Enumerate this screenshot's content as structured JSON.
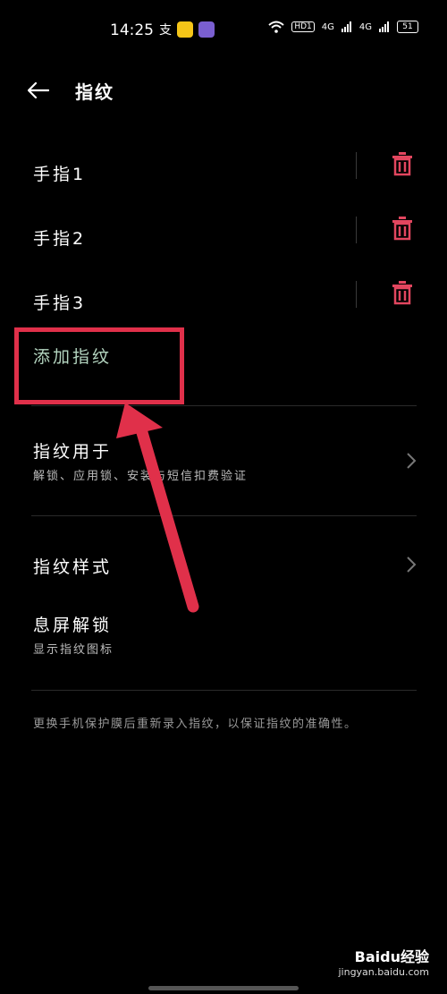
{
  "status_bar": {
    "time": "14:25",
    "hd_label": "HD1",
    "net1": "4G",
    "net2": "4G",
    "battery": "51"
  },
  "header": {
    "title": "指纹"
  },
  "fingers": [
    {
      "label": "手指1"
    },
    {
      "label": "手指2"
    },
    {
      "label": "手指3"
    }
  ],
  "add_fingerprint_label": "添加指纹",
  "fingerprint_use": {
    "title": "指纹用于",
    "subtitle": "解锁、应用锁、安装与短信扣费验证"
  },
  "fingerprint_style": {
    "title": "指纹样式"
  },
  "screen_off_unlock": {
    "title": "息屏解锁",
    "subtitle": "显示指纹图标"
  },
  "note": "更换手机保护膜后重新录入指纹，以保证指纹的准确性。",
  "watermark": {
    "brand": "Baidu经验",
    "url": "jingyan.baidu.com"
  },
  "colors": {
    "trash": "#e2465f",
    "highlight": "#e0304a",
    "add_text": "#b4d5c0"
  }
}
